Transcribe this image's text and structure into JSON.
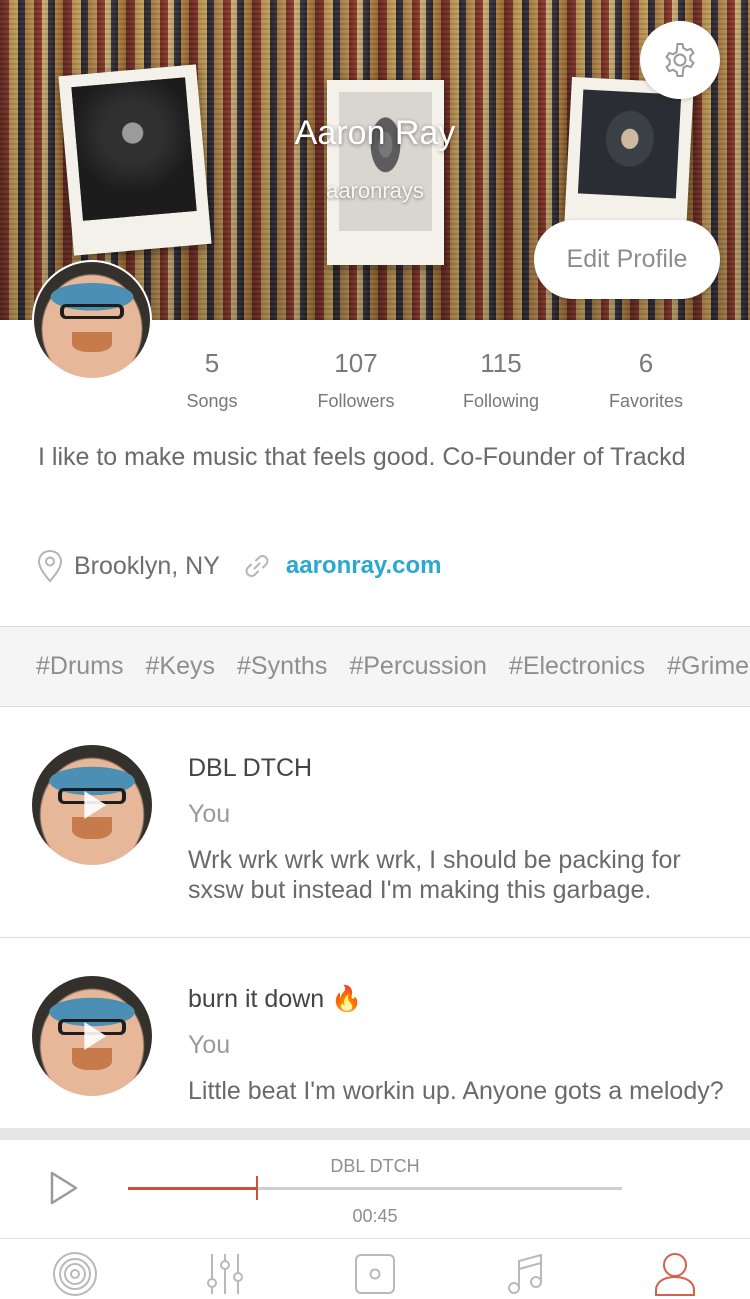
{
  "profile": {
    "name": "Aaron Ray",
    "handle": "aaronrays",
    "edit_label": "Edit Profile",
    "bio": "I like to make music that feels good. Co-Founder of Trackd",
    "location": "Brooklyn, NY",
    "website": "aaronray.com"
  },
  "stats": [
    {
      "value": "5",
      "label": "Songs"
    },
    {
      "value": "107",
      "label": "Followers"
    },
    {
      "value": "115",
      "label": "Following"
    },
    {
      "value": "6",
      "label": "Favorites"
    }
  ],
  "tags": [
    "#Drums",
    "#Keys",
    "#Synths",
    "#Percussion",
    "#Electronics",
    "#Grime"
  ],
  "feed": [
    {
      "title": "DBL DTCH",
      "author": "You",
      "description": "Wrk wrk wrk wrk wrk, I should be packing for sxsw but instead I'm making this garbage."
    },
    {
      "title": "burn it down",
      "emoji": "🔥",
      "author": "You",
      "description": "Little beat I'm workin up. Anyone gots a melody?"
    }
  ],
  "player": {
    "track_title": "DBL DTCH",
    "elapsed": "00:45",
    "progress": 0.26
  },
  "nav": {
    "items": [
      "vinyl-icon",
      "mixer-icon",
      "record-icon",
      "music-note-icon",
      "profile-icon"
    ],
    "active": "profile-icon"
  },
  "colors": {
    "accent": "#2aa8cf",
    "progress": "#c8523e",
    "nav_active": "#d5604c",
    "nav_inactive": "#b9b9b9"
  }
}
